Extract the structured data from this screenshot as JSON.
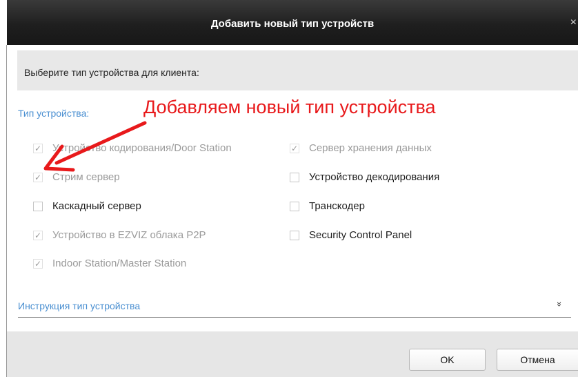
{
  "dialog": {
    "title": "Добавить новый тип устройств",
    "close_symbol": "×",
    "prompt": "Выберите тип устройства для клиента:",
    "section_label": "Тип устройства:",
    "annotation": "Добавляем новый тип устройства",
    "checkboxes": [
      {
        "label": "Устройство кодирования/Door Station",
        "checked": true,
        "disabled": true
      },
      {
        "label": "Стрим сервер",
        "checked": true,
        "disabled": true
      },
      {
        "label": "Каскадный сервер",
        "checked": false,
        "disabled": false
      },
      {
        "label": "Устройство в EZVIZ облака P2P",
        "checked": true,
        "disabled": true
      },
      {
        "label": "Indoor Station/Master Station",
        "checked": true,
        "disabled": true
      },
      {
        "label": "Сервер хранения данных",
        "checked": true,
        "disabled": true
      },
      {
        "label": "Устройство декодирования",
        "checked": false,
        "disabled": false
      },
      {
        "label": "Транскодер",
        "checked": false,
        "disabled": false
      },
      {
        "label": "Security Control Panel",
        "checked": false,
        "disabled": false
      }
    ],
    "instruction_label": "Инструкция тип устройства",
    "instruction_toggle": "»",
    "ok_label": "OK",
    "cancel_label": "Отмена",
    "check_glyph": "✓",
    "colors": {
      "accent": "#4a8fd1",
      "annotation": "#e8191b",
      "titlebar": "#1f1f1f"
    }
  }
}
